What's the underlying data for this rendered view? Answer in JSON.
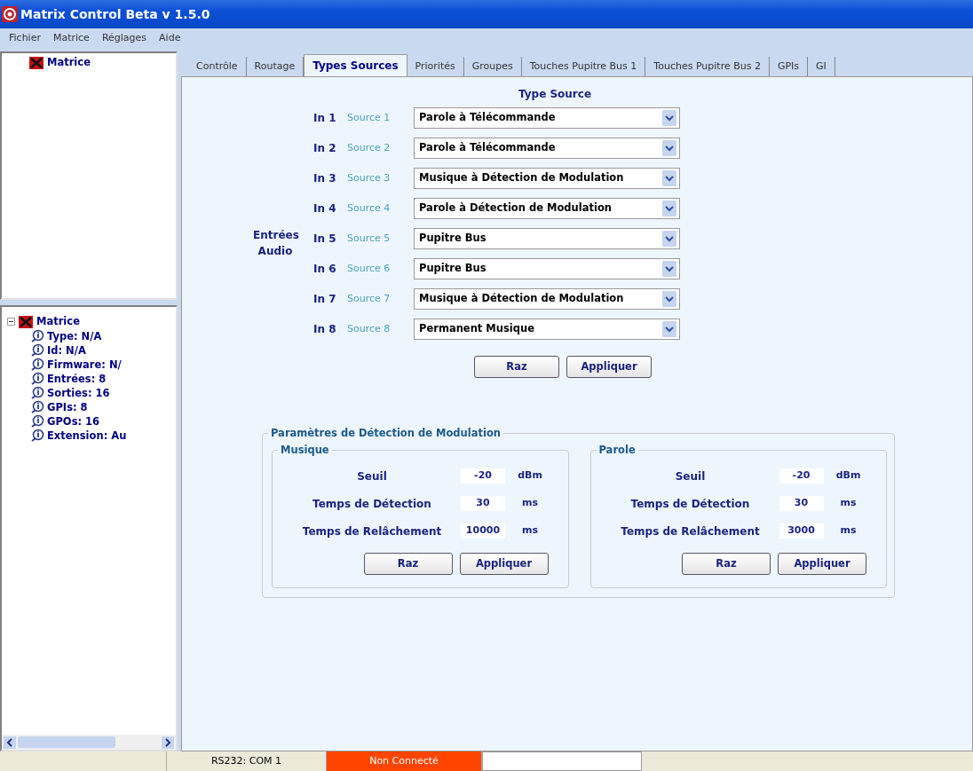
{
  "window": {
    "title": "Matrix Control Beta v 1.5.0"
  },
  "menu": [
    "Fichier",
    "Matrice",
    "Réglages",
    "Aide"
  ],
  "top_tree": {
    "label": "Matrice"
  },
  "info_tree": {
    "label": "Matrice",
    "expanded": true,
    "children": [
      {
        "label": "Type: N/A"
      },
      {
        "label": "Id: N/A"
      },
      {
        "label": "Firmware: N/"
      },
      {
        "label": "Entrées: 8"
      },
      {
        "label": "Sorties: 16"
      },
      {
        "label": "GPIs: 8"
      },
      {
        "label": "GPOs: 16"
      },
      {
        "label": "Extension: Au"
      }
    ]
  },
  "tabs": [
    {
      "label": "Contrôle",
      "selected": false
    },
    {
      "label": "Routage",
      "selected": false
    },
    {
      "label": "Types Sources",
      "selected": true
    },
    {
      "label": "Priorités",
      "selected": false
    },
    {
      "label": "Groupes",
      "selected": false
    },
    {
      "label": "Touches Pupitre Bus 1",
      "selected": false
    },
    {
      "label": "Touches Pupitre Bus 2",
      "selected": false
    },
    {
      "label": "GPIs",
      "selected": false
    },
    {
      "label": "GI",
      "selected": false
    }
  ],
  "type_source": {
    "title": "Type Source",
    "group_label": "Entrées Audio",
    "rows": [
      {
        "input": "In 1",
        "source": "Source 1",
        "value": "Parole à Télécommande"
      },
      {
        "input": "In 2",
        "source": "Source 2",
        "value": "Parole à Télécommande"
      },
      {
        "input": "In 3",
        "source": "Source 3",
        "value": "Musique à Détection de Modulation"
      },
      {
        "input": "In 4",
        "source": "Source 4",
        "value": "Parole à Détection de Modulation"
      },
      {
        "input": "In 5",
        "source": "Source 5",
        "value": "Pupitre Bus"
      },
      {
        "input": "In 6",
        "source": "Source 6",
        "value": "Pupitre Bus"
      },
      {
        "input": "In 7",
        "source": "Source 7",
        "value": "Musique à Détection de Modulation"
      },
      {
        "input": "In 8",
        "source": "Source 8",
        "value": "Permanent Musique"
      }
    ],
    "buttons": [
      "Raz",
      "Appliquer"
    ]
  },
  "detection": {
    "title": "Paramètres de Détection de Modulation",
    "groups": [
      {
        "title": "Musique",
        "fields": [
          {
            "label": "Seuil",
            "value": "-20",
            "unit": "dBm"
          },
          {
            "label": "Temps de Détection",
            "value": "30",
            "unit": "ms"
          },
          {
            "label": "Temps de Relâchement",
            "value": "10000",
            "unit": "ms"
          }
        ],
        "buttons": [
          "Raz",
          "Appliquer"
        ]
      },
      {
        "title": "Parole",
        "fields": [
          {
            "label": "Seuil",
            "value": "-20",
            "unit": "dBm"
          },
          {
            "label": "Temps de Détection",
            "value": "30",
            "unit": "ms"
          },
          {
            "label": "Temps de Relâchement",
            "value": "3000",
            "unit": "ms"
          }
        ],
        "buttons": [
          "Raz",
          "Appliquer"
        ]
      }
    ]
  },
  "status_bar": {
    "port": "RS232: COM 1",
    "connection": "Non Connecté",
    "connected": false
  }
}
